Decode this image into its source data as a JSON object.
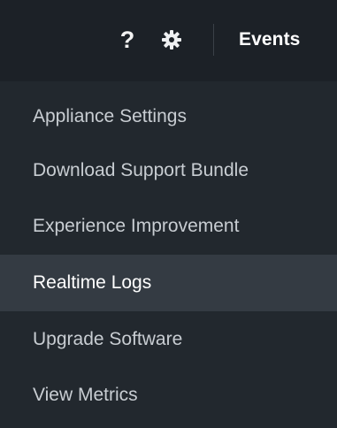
{
  "header": {
    "help_icon": "?",
    "events_label": "Events",
    "icons": [
      "help-icon",
      "gear-icon"
    ]
  },
  "menu": {
    "items": [
      {
        "label": "Appliance Settings",
        "active": false
      },
      {
        "label": "Download Support Bundle",
        "active": false
      },
      {
        "label": "Experience Improvement",
        "active": false
      },
      {
        "label": "Realtime Logs",
        "active": true
      },
      {
        "label": "Upgrade Software",
        "active": false
      },
      {
        "label": "View Metrics",
        "active": false
      }
    ]
  },
  "colors": {
    "header_background": "#1c2127",
    "menu_background": "#22282e",
    "active_background": "#343b43",
    "active_text": "#ffffff",
    "text": "#c8cdd2"
  }
}
